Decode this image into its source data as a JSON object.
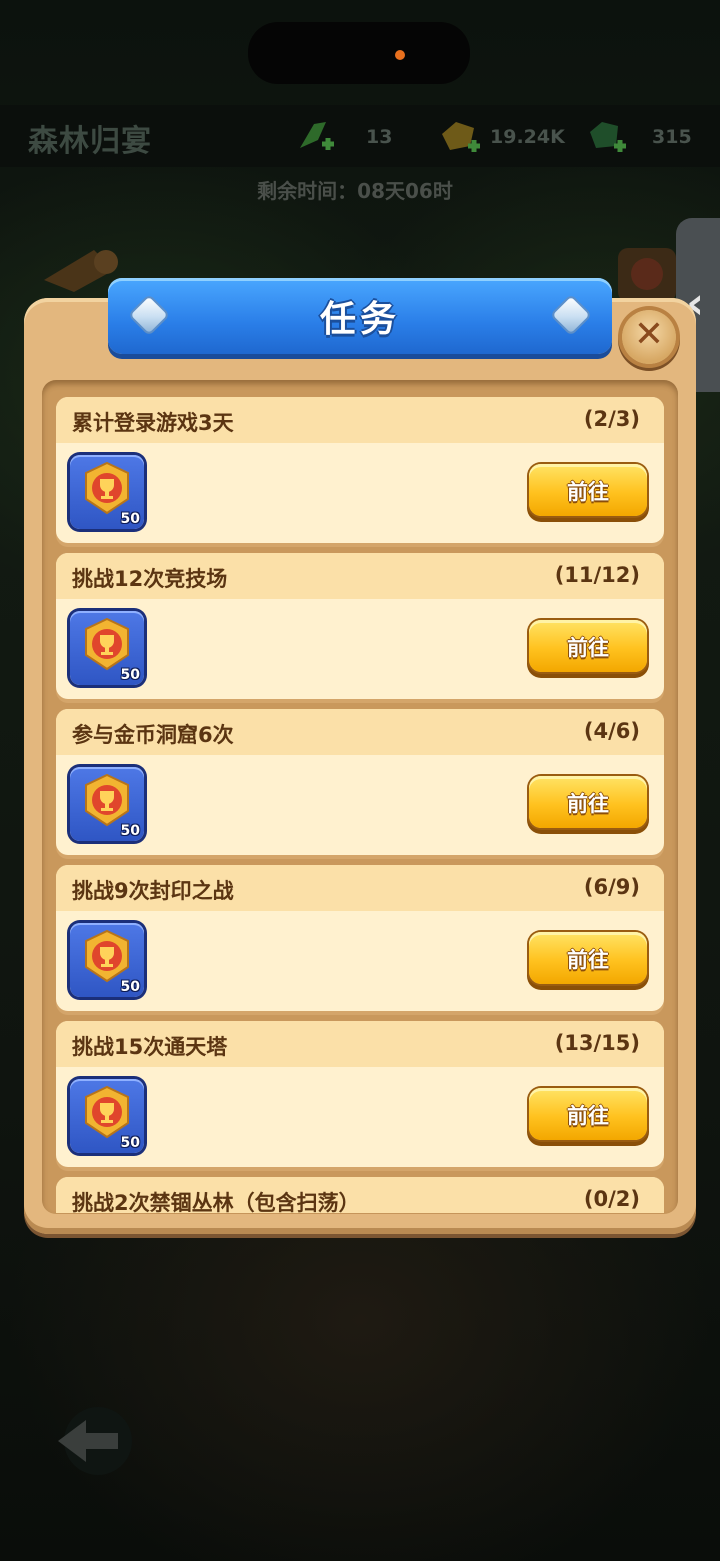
{
  "header": {
    "title": "森林归宴",
    "resources": [
      {
        "icon": "green-leaf-icon",
        "value": "13"
      },
      {
        "icon": "gold-coin-icon",
        "value": "19.24K"
      },
      {
        "icon": "green-gem-icon",
        "value": "315"
      }
    ],
    "timer": "剩余时间：08天06时"
  },
  "dialog": {
    "title": "任务",
    "close_icon": "close-icon",
    "tasks": [
      {
        "name": "累计登录游戏3天",
        "progress": "(2/3)",
        "reward_icon": "trophy-badge-icon",
        "reward_amount": "50",
        "button": "前往"
      },
      {
        "name": "挑战12次竞技场",
        "progress": "(11/12)",
        "reward_icon": "trophy-badge-icon",
        "reward_amount": "50",
        "button": "前往"
      },
      {
        "name": "参与金币洞窟6次",
        "progress": "(4/6)",
        "reward_icon": "trophy-badge-icon",
        "reward_amount": "50",
        "button": "前往"
      },
      {
        "name": "挑战9次封印之战",
        "progress": "(6/9)",
        "reward_icon": "trophy-badge-icon",
        "reward_amount": "50",
        "button": "前往"
      },
      {
        "name": "挑战15次通天塔",
        "progress": "(13/15)",
        "reward_icon": "trophy-badge-icon",
        "reward_amount": "50",
        "button": "前往"
      },
      {
        "name": "挑战2次禁锢丛林（包含扫荡）",
        "progress": "(0/2)",
        "reward_icon": "trophy-badge-icon",
        "reward_amount": "",
        "button": ""
      }
    ]
  },
  "side_tab_icon": "chevron-left-icon",
  "back_icon": "back-arrow-icon",
  "colors": {
    "banner_blue": "#2a7ee8",
    "button_yellow": "#ffc21f",
    "panel_tan": "#e3b77e",
    "card_cream": "#fff1cf",
    "text_brown": "#5b3512"
  }
}
